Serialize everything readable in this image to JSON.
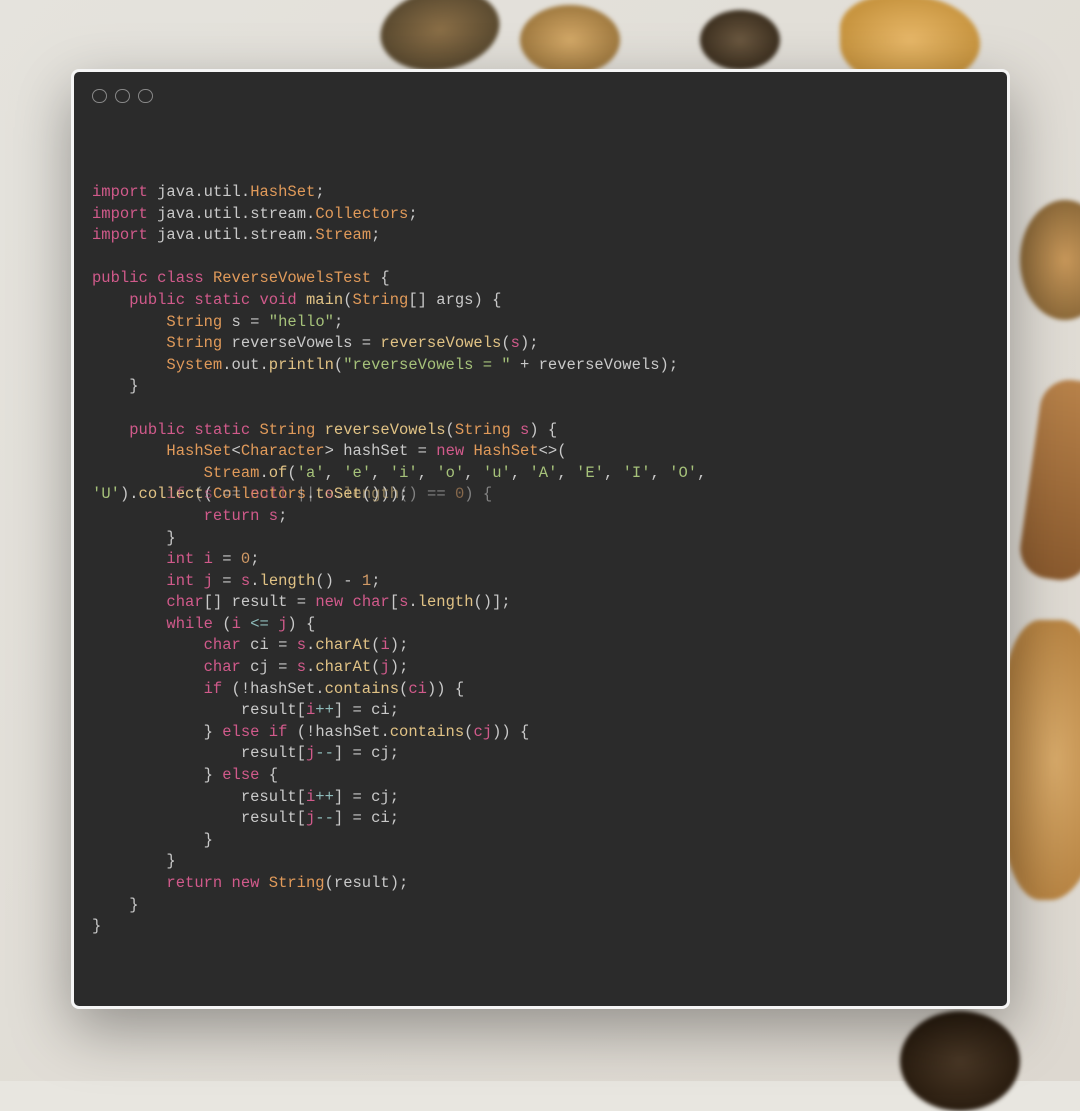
{
  "window": {
    "traffic_light_count": 3
  },
  "code": {
    "language": "java",
    "class_name": "ReverseVowelsTest",
    "imports": [
      "java.util.HashSet",
      "java.util.stream.Collectors",
      "java.util.stream.Stream"
    ],
    "main": {
      "s_value": "hello",
      "println_prefix": "reverseVowels = "
    },
    "reverseVowels": {
      "vowel_chars": [
        "a",
        "e",
        "i",
        "o",
        "u",
        "A",
        "E",
        "I",
        "O",
        "U"
      ],
      "overlapping_line_a": "'U').collect(Collectors.toSet()));",
      "overlapping_line_b": "        if (s == null || s.length() == 0) {"
    },
    "tokens": {
      "import": "import",
      "public": "public",
      "class": "class",
      "static": "static",
      "void": "void",
      "main": "main",
      "String": "String",
      "args": "args",
      "s": "s",
      "reverseVowels": "reverseVowels",
      "System": "System",
      "out": "out",
      "println": "println",
      "HashSet": "HashSet",
      "Character": "Character",
      "hashSet": "hashSet",
      "new": "new",
      "Stream": "Stream",
      "of": "of",
      "collect": "collect",
      "Collectors": "Collectors",
      "toSet": "toSet",
      "if": "if",
      "null": "null",
      "length": "length",
      "return": "return",
      "int": "int",
      "i": "i",
      "j": "j",
      "char": "char",
      "result": "result",
      "while": "while",
      "ci": "ci",
      "cj": "cj",
      "charAt": "charAt",
      "contains": "contains",
      "else": "else",
      "num0": "0",
      "num1": "1"
    }
  }
}
